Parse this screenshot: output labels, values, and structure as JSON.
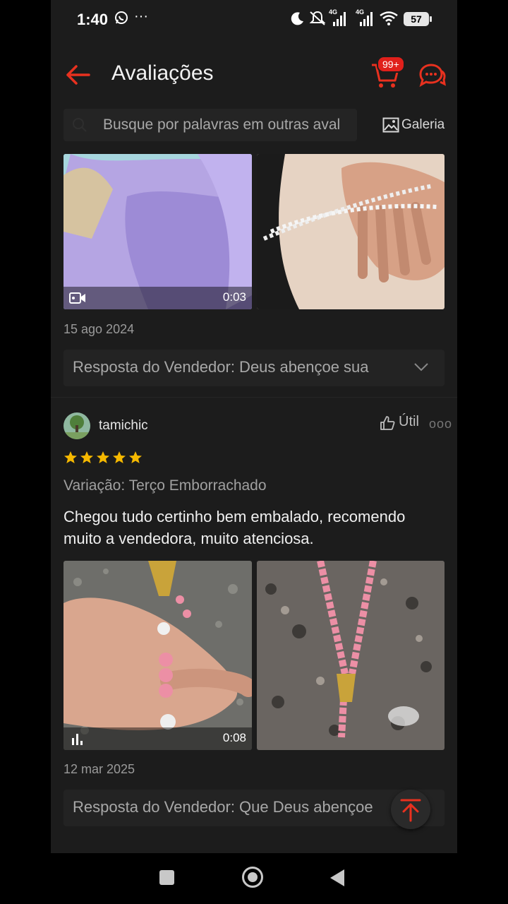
{
  "status_bar": {
    "time": "1:40",
    "dots": "···",
    "network_1": "4G",
    "network_2": "4G",
    "battery": "57"
  },
  "header": {
    "title": "Avaliações",
    "cart_badge": "99+"
  },
  "search": {
    "placeholder": "Busque por palavras em outras aval",
    "gallery_label": "Galeria"
  },
  "review_1": {
    "video_duration": "0:03",
    "date": "15 ago 2024",
    "seller_reply": "Resposta do Vendedor: Deus abençoe sua"
  },
  "review_2": {
    "username": "tamichic",
    "helpful_label": "Útil",
    "more": "ooo",
    "rating": 5,
    "variation": "Variação: Terço Emborrachado",
    "comment": "Chegou tudo certinho bem embalado, recomendo muito a vendedora, muito atenciosa.",
    "video_duration": "0:08",
    "date": "12 mar 2025",
    "seller_reply": "Resposta do Vendedor: Que Deus abençoe"
  },
  "colors": {
    "accent": "#e8311f",
    "background": "#1c1c1c",
    "star": "#f5b800"
  }
}
